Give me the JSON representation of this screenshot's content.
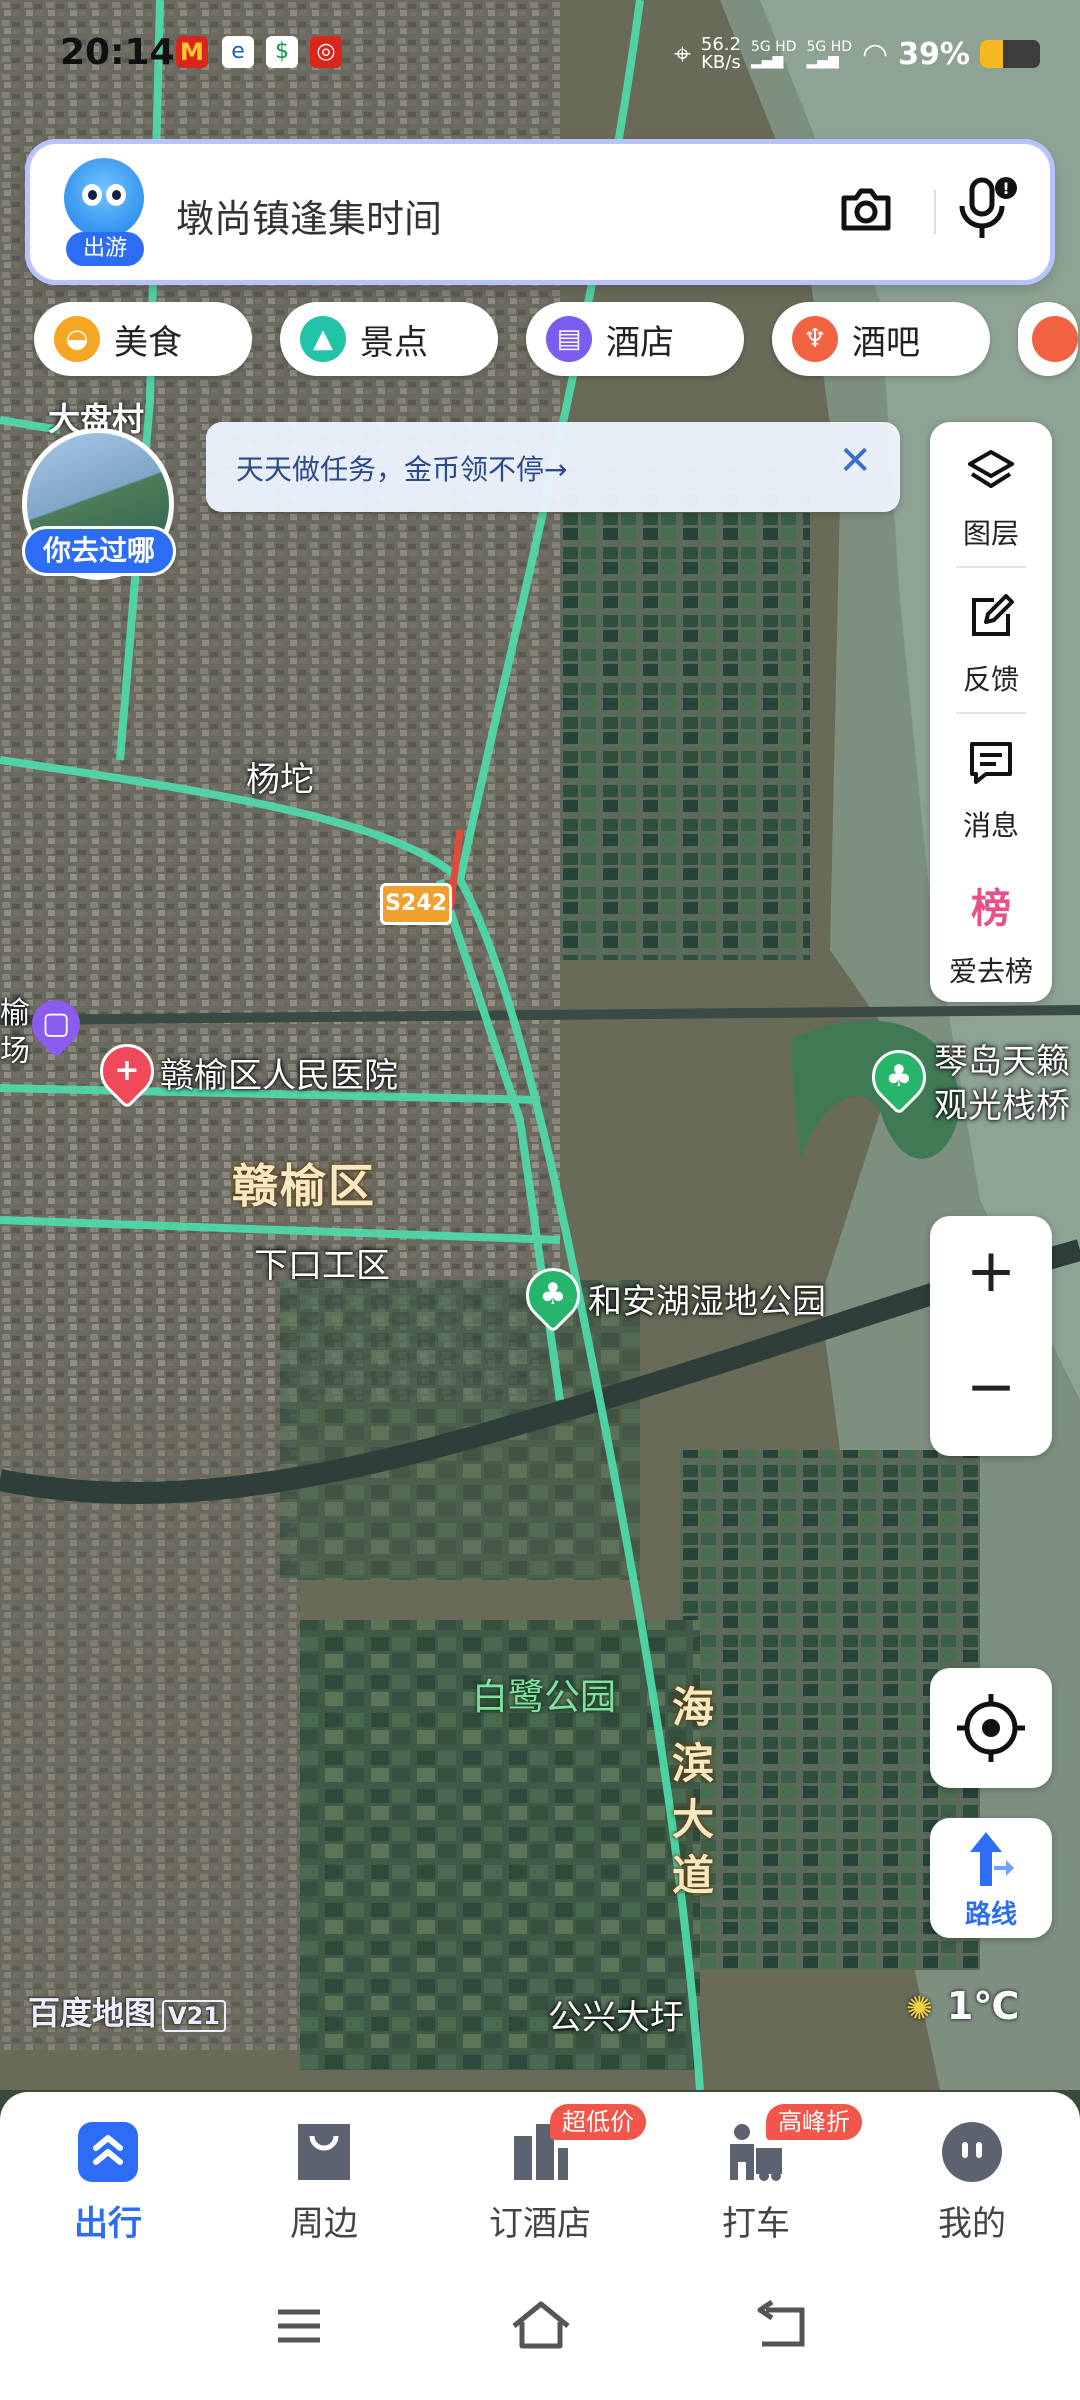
{
  "status_bar": {
    "time": "20:14",
    "net_speed_value": "56.2",
    "net_speed_unit": "KB/s",
    "signal_1": "5G HD",
    "signal_2": "5G HD",
    "battery": "39%",
    "battery_level": 0.39,
    "app_icons": [
      "mcdonalds-icon",
      "china-telecom-icon",
      "bank-icon",
      "target-icon"
    ]
  },
  "search": {
    "mascot_tag": "出游",
    "placeholder": "墩尚镇逢集时间"
  },
  "categories": [
    {
      "label": "美食",
      "icon": "food-icon",
      "color": "#f5a623"
    },
    {
      "label": "景点",
      "icon": "scenery-icon",
      "color": "#22c3a6"
    },
    {
      "label": "酒店",
      "icon": "hotel-icon",
      "color": "#7a5cf0"
    },
    {
      "label": "酒吧",
      "icon": "bar-icon",
      "color": "#f06240"
    }
  ],
  "promo": {
    "village_name": "大盘村",
    "button_label": "你去过哪",
    "banner_text": "天天做任务，金币领不停→"
  },
  "right_panel": {
    "layers": "图层",
    "feedback": "反馈",
    "messages": "消息",
    "ranking": "爱去榜"
  },
  "map": {
    "district": "赣榆区",
    "road_shield": "S242",
    "coastal_road": [
      "海",
      "滨",
      "大",
      "道"
    ],
    "labels": {
      "yangtuo": "杨坨",
      "hospital": "赣榆区人民医院",
      "industrial": "下口工区",
      "wetland": "和安湖湿地公园",
      "egret_park": "白鹭公园",
      "gongxing": "公兴大圩",
      "qindao_1": "琴岛天籁",
      "qindao_2": "观光栈桥",
      "left_cut_1": "榆",
      "left_cut_2": "场"
    },
    "brand": "百度地图",
    "brand_version": "V21",
    "temperature": "1℃"
  },
  "zoom": {
    "in": "+",
    "out": "−"
  },
  "route_label": "路线",
  "tabs": [
    {
      "label": "出行",
      "active": true
    },
    {
      "label": "周边",
      "active": false
    },
    {
      "label": "订酒店",
      "badge": "超低价",
      "active": false
    },
    {
      "label": "打车",
      "badge": "高峰折",
      "active": false
    },
    {
      "label": "我的",
      "active": false
    }
  ],
  "colors": {
    "accent": "#2d6df6",
    "badge": "#f2554a",
    "road": "#4fd8a8"
  }
}
